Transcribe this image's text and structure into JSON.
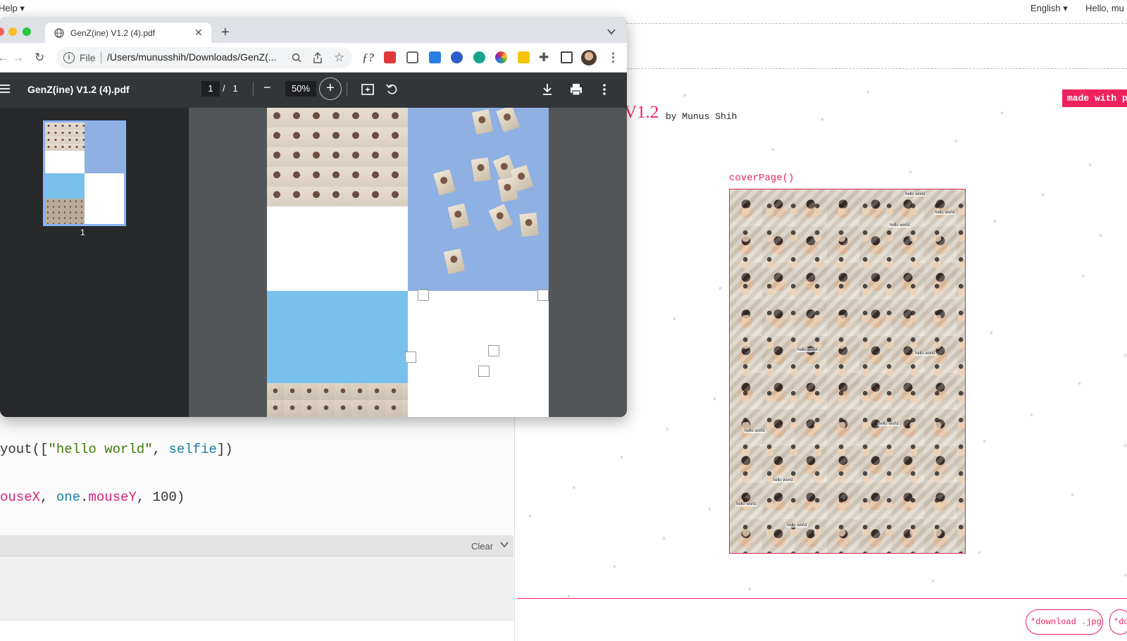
{
  "topbar": {
    "help": "Help ▾",
    "language": "English ▾",
    "greeting": "Hello, mu"
  },
  "sketch": {
    "title_version": "V1.2",
    "byline": "by Munus Shih",
    "made_with": "made with p",
    "cover_label": "coverPage()",
    "cover_tag": "hello world",
    "download_jpg": "*download .jpg*",
    "download_more": "*do"
  },
  "code": {
    "line1_prefix": "yout([",
    "line1_str": "\"hello world\"",
    "line1_sep": ", ",
    "line1_var": "selfie",
    "line1_end": "])",
    "line2_a": "ouseX",
    "line2_sep": ", ",
    "line2_obj": "one",
    "line2_dot": ".",
    "line2_b": "mouseY",
    "line2_end": ", 100)"
  },
  "console": {
    "clear_label": "Clear"
  },
  "chrome": {
    "tab_title": "GenZ(ine) V1.2 (4).pdf",
    "tab_close": "✕",
    "new_tab": "+",
    "omnibox_info": "i",
    "omnibox_file": "File",
    "omnibox_url": "/Users/munusshih/Downloads/GenZ(..."
  },
  "pdf": {
    "title": "GenZ(ine) V1.2 (4).pdf",
    "page_current": "1",
    "page_sep": "/",
    "page_total": "1",
    "zoom": "50%",
    "minus": "−",
    "plus": "+",
    "thumb_page": "1"
  },
  "colors": {
    "accent": "#ed225d",
    "pdf_toolbar": "#323639",
    "pdf_bg": "#525659",
    "blue_quadrant": "#8fb0e2",
    "sky_quadrant": "#79c1ec"
  }
}
